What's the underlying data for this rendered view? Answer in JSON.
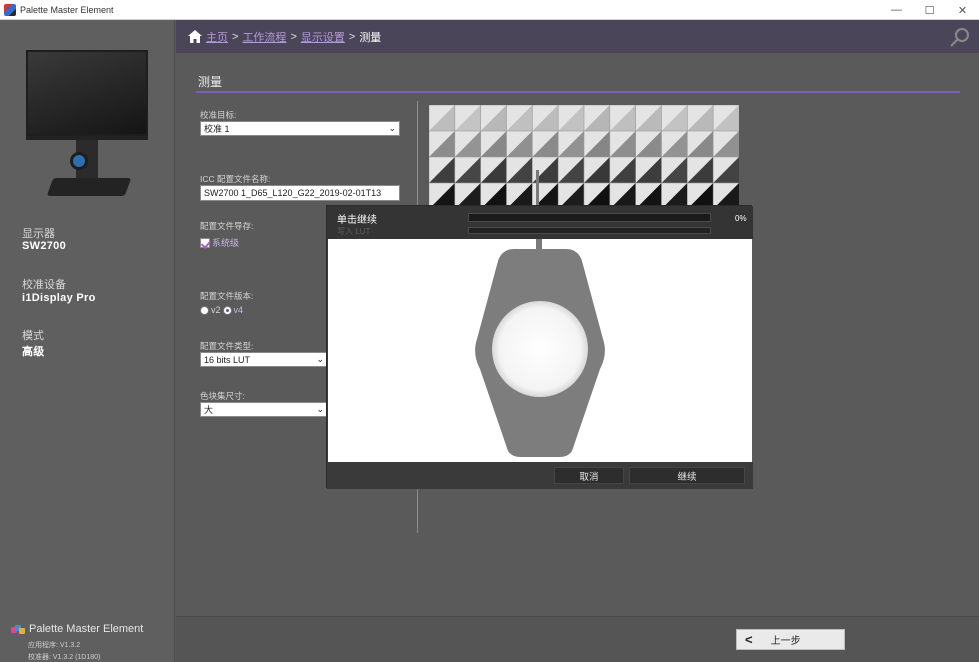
{
  "window": {
    "title": "Palette Master Element",
    "controls": {
      "minimize": "—",
      "maximize": "☐",
      "close": "✕"
    }
  },
  "sidebar": {
    "display_label": "显示器",
    "display_value": "SW2700",
    "device_label": "校准设备",
    "device_value": "i1Display Pro",
    "mode_label": "模式",
    "mode_value": "高级",
    "brand": "Palette Master Element",
    "app_version": "应用程序:  V1.3.2",
    "cal_version": "校准器:  V1.3.2 (1D180)"
  },
  "header": {
    "crumbs": [
      "主页",
      "工作流程",
      "显示设置"
    ],
    "current": "测量",
    "separator": ">"
  },
  "main": {
    "section_title": "测量",
    "calibration_target_label": "校准目标:",
    "calibration_target_value": "校准 1",
    "icc_label": "ICC 配置文件名称:",
    "icc_value": "SW2700 1_D65_L120_G22_2019-02-01T13",
    "profile_store_label": "配置文件导存:",
    "profile_store_option": "系统级",
    "profile_version_label": "配置文件版本:",
    "profile_version_options": [
      "v2",
      "v4"
    ],
    "profile_version_selected": "v4",
    "profile_type_label": "配置文件类型:",
    "profile_type_value": "16 bits LUT",
    "patch_size_label": "色块集尺寸:",
    "patch_size_value": "大"
  },
  "footer": {
    "back_label": "上一步"
  },
  "modal": {
    "title": "单击继续",
    "subtitle": "写入 LUT",
    "progress_percent": 0,
    "progress_text": "0%",
    "cancel_label": "取消",
    "continue_label": "继续"
  },
  "colors": {
    "accent": "#7a5fb8",
    "header_bg": "#4a4558",
    "link": "#b59ad9",
    "progress_fill": "#2f7a2f"
  }
}
